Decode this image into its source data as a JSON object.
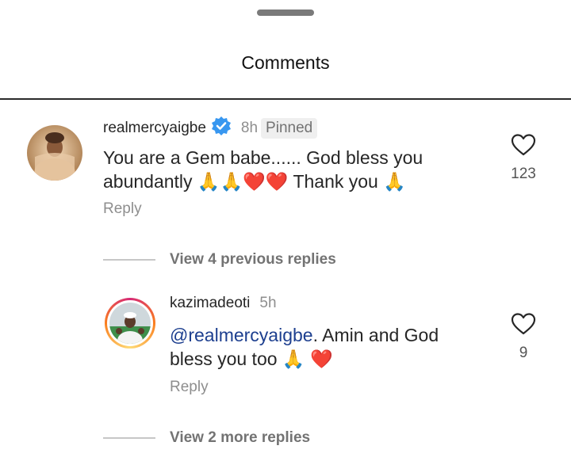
{
  "header": {
    "title": "Comments"
  },
  "comments": [
    {
      "username": "realmercyaigbe",
      "verified": true,
      "time": "8h",
      "pinned_label": "Pinned",
      "text_line1": "You are a Gem babe...... God bless you",
      "text_line2": "abundantly 🙏🙏❤️❤️ Thank you 🙏",
      "reply_label": "Reply",
      "likes": "123",
      "view_replies_label": "View 4 previous replies"
    },
    {
      "username": "kazimadeoti",
      "time": "5h",
      "mention": "@realmercyaigbe",
      "text_rest": ". Amin and God",
      "text_line2": "bless you too 🙏 ❤️",
      "reply_label": "Reply",
      "likes": "9",
      "view_replies_label": "View 2 more replies"
    }
  ],
  "colors": {
    "verified": "#3897f0",
    "mention": "#1d3f8f",
    "muted": "#8e8e8e"
  }
}
